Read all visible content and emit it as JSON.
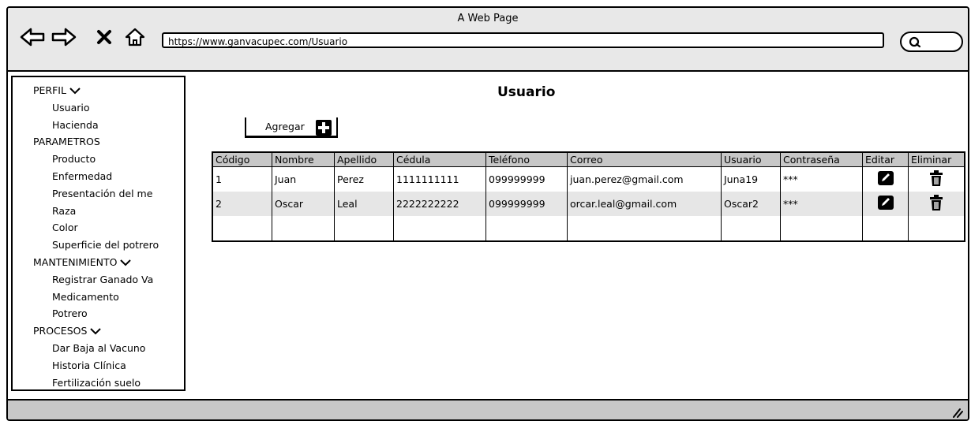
{
  "window": {
    "title": "A Web Page"
  },
  "toolbar": {
    "url": "https://www.ganvacupec.com/Usuario"
  },
  "sidebar": {
    "groups": [
      {
        "label": "PERFIL",
        "items": [
          "Usuario",
          "Hacienda"
        ]
      },
      {
        "label": "PARAMETROS",
        "items": [
          "Producto",
          "Enfermedad",
          "Presentación del me",
          "Raza",
          "Color",
          "Superficie del potrero"
        ]
      },
      {
        "label": "MANTENIMIENTO",
        "items": [
          "Registrar Ganado Va",
          "Medicamento",
          "Potrero"
        ]
      },
      {
        "label": "PROCESOS",
        "items": [
          "Dar Baja al Vacuno",
          "Historia Clínica",
          "Fertilización suelo"
        ]
      }
    ]
  },
  "main": {
    "title": "Usuario",
    "add_label": "Agregar",
    "table": {
      "headers": [
        "Código",
        "Nombre",
        "Apellido",
        "Cédula",
        "Teléfono",
        "Correo",
        "Usuario",
        "Contraseña",
        "Editar",
        "Eliminar"
      ],
      "rows": [
        [
          "1",
          "Juan",
          "Perez",
          "1111111111",
          "099999999",
          "juan.perez@gmail.com",
          "Juna19",
          "***"
        ],
        [
          "2",
          "Oscar",
          "Leal",
          "2222222222",
          "099999999",
          "orcar.leal@gmail.com",
          "Oscar2",
          "***"
        ]
      ]
    }
  },
  "icons": {
    "back": "arrow-left-icon",
    "forward": "arrow-right-icon",
    "stop": "close-icon",
    "home": "home-icon",
    "search": "search-icon",
    "add": "plus-icon",
    "edit": "pencil-icon",
    "delete": "trash-icon"
  }
}
